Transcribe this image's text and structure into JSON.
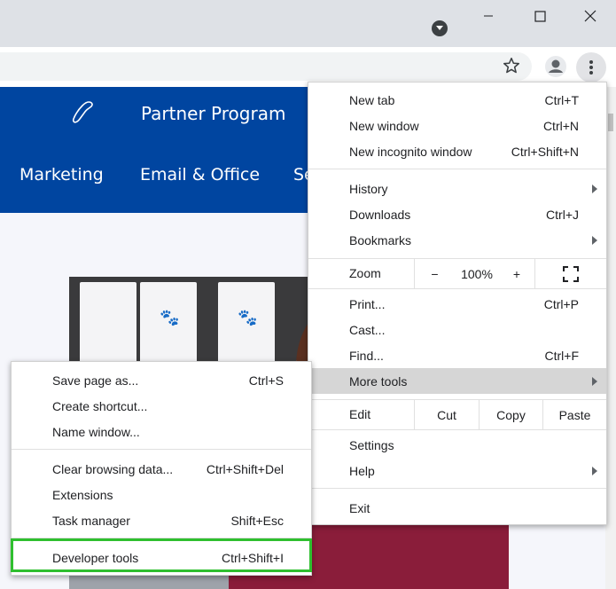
{
  "window": {
    "tab_search_icon": "chevron-down-circle-icon",
    "minimize_icon": "minimize-icon",
    "maximize_icon": "maximize-icon",
    "close_icon": "close-icon"
  },
  "toolbar": {
    "bookmark_icon": "star-icon",
    "profile_icon": "person-icon",
    "menu_icon": "three-dots-vertical-icon"
  },
  "page": {
    "partner_program": "Partner Program",
    "nav": [
      "Marketing",
      "Email & Office",
      "Se"
    ],
    "brand_color": "#0045a0"
  },
  "main_menu": {
    "new_tab": {
      "label": "New tab",
      "shortcut": "Ctrl+T"
    },
    "new_window": {
      "label": "New window",
      "shortcut": "Ctrl+N"
    },
    "new_incognito": {
      "label": "New incognito window",
      "shortcut": "Ctrl+Shift+N"
    },
    "history": {
      "label": "History"
    },
    "downloads": {
      "label": "Downloads",
      "shortcut": "Ctrl+J"
    },
    "bookmarks": {
      "label": "Bookmarks"
    },
    "zoom": {
      "label": "Zoom",
      "minus": "−",
      "value": "100%",
      "plus": "+"
    },
    "print": {
      "label": "Print...",
      "shortcut": "Ctrl+P"
    },
    "cast": {
      "label": "Cast..."
    },
    "find": {
      "label": "Find...",
      "shortcut": "Ctrl+F"
    },
    "more_tools": {
      "label": "More tools"
    },
    "edit": {
      "label": "Edit",
      "cut": "Cut",
      "copy": "Copy",
      "paste": "Paste"
    },
    "settings": {
      "label": "Settings"
    },
    "help": {
      "label": "Help"
    },
    "exit": {
      "label": "Exit"
    }
  },
  "more_tools_menu": {
    "save_page": {
      "label": "Save page as...",
      "shortcut": "Ctrl+S"
    },
    "create_shortcut": {
      "label": "Create shortcut..."
    },
    "name_window": {
      "label": "Name window..."
    },
    "clear_browsing": {
      "label": "Clear browsing data...",
      "shortcut": "Ctrl+Shift+Del"
    },
    "extensions": {
      "label": "Extensions"
    },
    "task_manager": {
      "label": "Task manager",
      "shortcut": "Shift+Esc"
    },
    "developer_tools": {
      "label": "Developer tools",
      "shortcut": "Ctrl+Shift+I"
    }
  },
  "highlight_color": "#2fbf2f"
}
